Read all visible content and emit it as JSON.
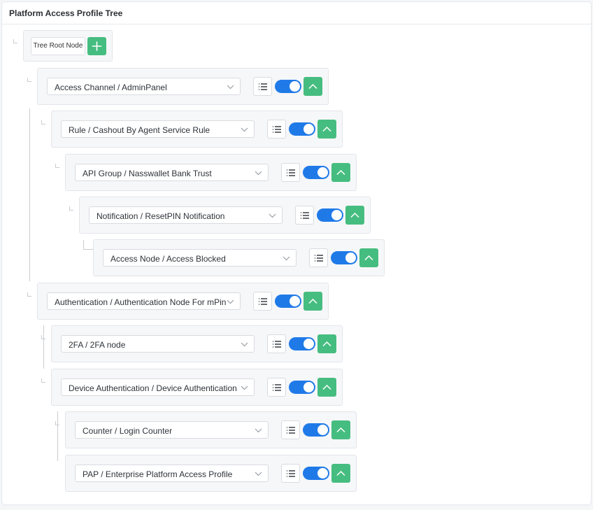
{
  "panel": {
    "title": "Platform Access Profile Tree"
  },
  "root": {
    "label": "Tree Root Node",
    "add_icon": "plus-icon"
  },
  "icons": {
    "dropdown": "chevron-down-icon",
    "list": "list-icon",
    "collapse": "chevron-up-icon"
  },
  "colors": {
    "accent_green": "#46bd80",
    "toggle_blue": "#1f7ae8"
  },
  "nodes": [
    {
      "label": "Access Channel / AdminPanel",
      "enabled": true
    },
    {
      "label": "Rule / Cashout By Agent Service Rule",
      "enabled": true
    },
    {
      "label": "API Group / Nasswallet Bank Trust",
      "enabled": true
    },
    {
      "label": "Notification / ResetPIN Notification",
      "enabled": true
    },
    {
      "label": "Access Node / Access Blocked",
      "enabled": true
    },
    {
      "label": "Authentication / Authentication Node For mPin",
      "enabled": true
    },
    {
      "label": "2FA / 2FA node",
      "enabled": true
    },
    {
      "label": "Device Authentication / Device Authentication",
      "enabled": true
    },
    {
      "label": "Counter / Login Counter",
      "enabled": true
    },
    {
      "label": "PAP / Enterprise Platform Access Profile",
      "enabled": true
    }
  ]
}
